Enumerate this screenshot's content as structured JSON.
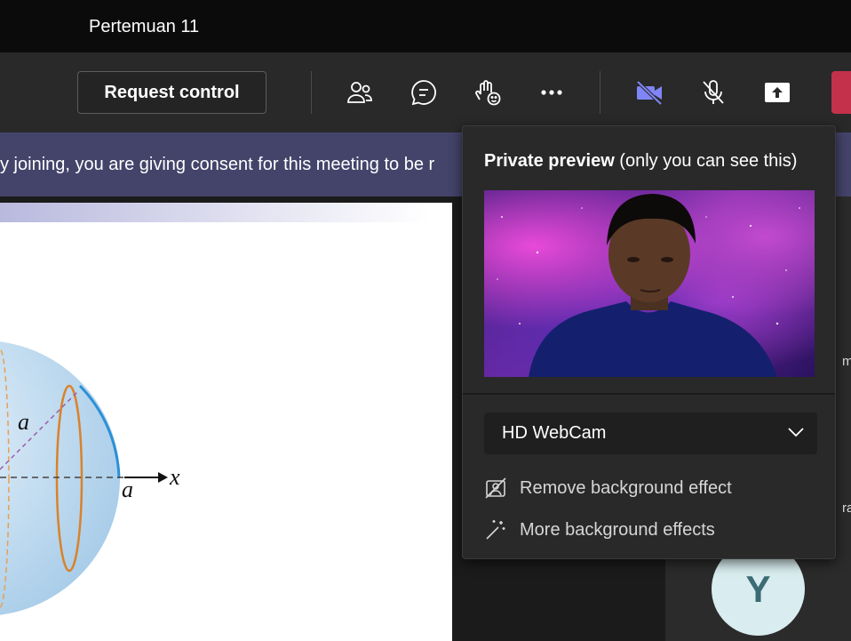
{
  "window": {
    "title": "Pertemuan 11"
  },
  "toolbar": {
    "request_control_label": "Request control",
    "icons": [
      "people-icon",
      "chat-icon",
      "raise-hand-icon",
      "more-icon",
      "camera-off-icon",
      "mic-off-icon",
      "share-icon"
    ]
  },
  "consent": {
    "text": "y joining, you are giving consent for this meeting to be r"
  },
  "slide": {
    "label_a1": "a",
    "label_a2": "a",
    "label_x": "x"
  },
  "participants": {
    "avatar_initial": "Y",
    "edge_text_1": "m",
    "edge_text_2": "ra"
  },
  "preview_popup": {
    "title_bold": "Private preview",
    "title_rest": " (only you can see this)",
    "camera_select": "HD WebCam",
    "options": [
      {
        "label": "Remove background effect",
        "icon": "no-background-icon"
      },
      {
        "label": "More background effects",
        "icon": "magic-wand-icon"
      }
    ]
  },
  "colors": {
    "accent": "#7f85f5",
    "consent_bar": "#44446b",
    "leave": "#c4314b"
  }
}
